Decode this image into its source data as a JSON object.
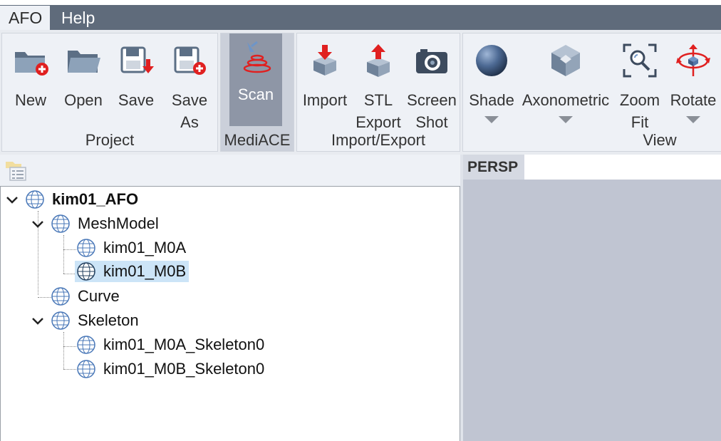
{
  "menu": {
    "items": [
      "AFO",
      "Help"
    ]
  },
  "ribbon": {
    "groups": {
      "project": {
        "label": "Project",
        "buttons": {
          "new": "New",
          "open": "Open",
          "save": "Save",
          "save_as": [
            "Save",
            "As"
          ]
        }
      },
      "mediace": {
        "label": "MediACE",
        "buttons": {
          "scan": "Scan"
        }
      },
      "import_export": {
        "label": "Import/Export",
        "buttons": {
          "import": "Import",
          "stl_export": [
            "STL",
            "Export"
          ],
          "screen_shot": [
            "Screen",
            "Shot"
          ]
        }
      },
      "view": {
        "label": "View",
        "buttons": {
          "shade": "Shade",
          "axonometric": "Axonometric",
          "zoom_fit": [
            "Zoom",
            "Fit"
          ],
          "rotate": "Rotate"
        }
      }
    }
  },
  "tree": {
    "root": "kim01_AFO",
    "meshmodel": "MeshModel",
    "m0a": "kim01_M0A",
    "m0b": "kim01_M0B",
    "curve": "Curve",
    "skeleton": "Skeleton",
    "m0a_skel": "kim01_M0A_Skeleton0",
    "m0b_skel": "kim01_M0B_Skeleton0",
    "selected": "kim01_M0B"
  },
  "viewport": {
    "tab": "PERSP"
  },
  "colors": {
    "menubar": "#5f6b7b",
    "ribbon": "#eef1f6",
    "scan_active": "#8e96a6",
    "selection": "#cce4f7",
    "viewport": "#c0c5d2"
  }
}
